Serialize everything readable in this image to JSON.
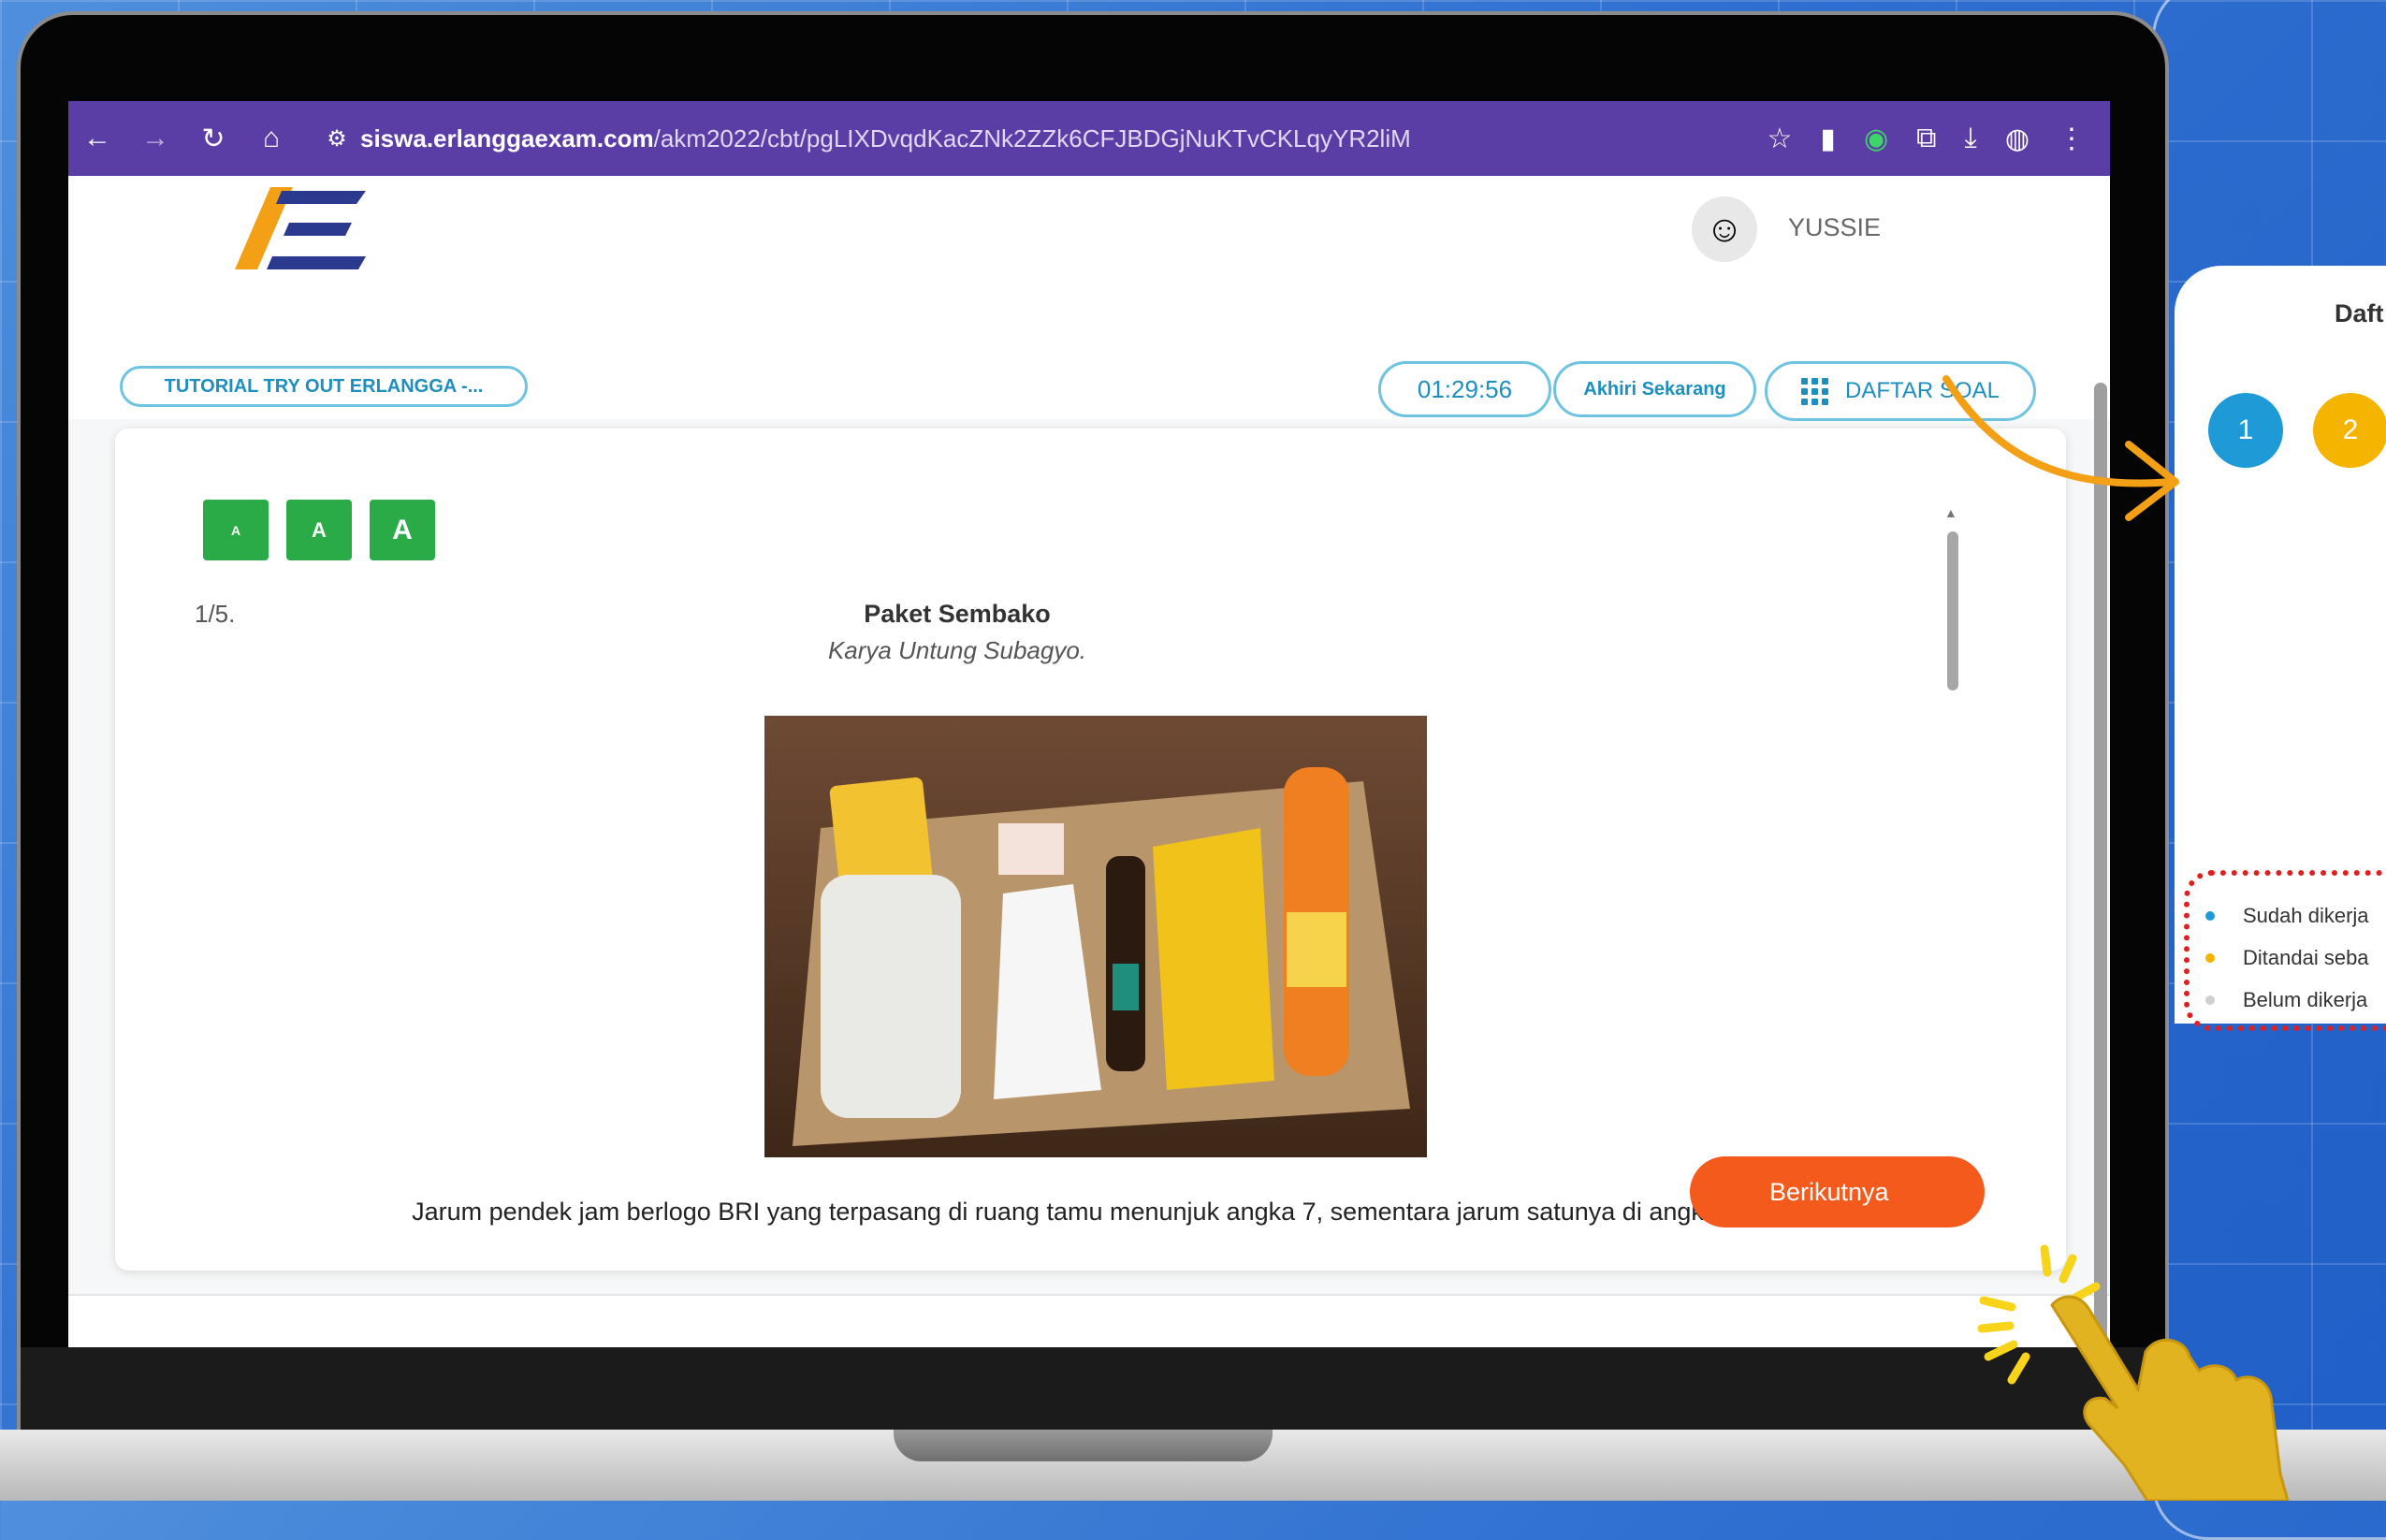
{
  "browser": {
    "url_host": "siswa.erlanggaexam.com",
    "url_path": "/akm2022/cbt/pgLIXDvqdKacZNk2ZZk6CFJBDGjNuKTvCKLqyYR2liM"
  },
  "header": {
    "username": "YUSSIE",
    "tutorial_label": "TUTORIAL TRY OUT ERLANGGA -...",
    "timer": "01:29:56",
    "end_label": "Akhiri Sekarang",
    "question_list_label": "DAFTAR SOAL"
  },
  "font_sizes": [
    "A",
    "A",
    "A"
  ],
  "question": {
    "number": "1/5.",
    "title": "Paket Sembako",
    "author": "Karya Untung Subagyo.",
    "text": "Jarum pendek jam berlogo BRI yang terpasang di ruang tamu menunjuk angka 7, sementara jarum satunya di angka 6."
  },
  "footer": {
    "next_label": "Berikutnya"
  },
  "side_panel": {
    "title": "Daft",
    "numbers": [
      "1",
      "2"
    ],
    "legend": [
      {
        "label": "Sudah dikerja",
        "color": "#1e9ad6"
      },
      {
        "label": "Ditandai seba",
        "color": "#f5b400"
      },
      {
        "label": "Belum dikerja",
        "color": "#cfcfcf"
      }
    ]
  },
  "colors": {
    "browser_bar": "#5b3da6",
    "next_button": "#f35a1c",
    "font_button": "#2bab47",
    "accent": "#1d8fbf"
  }
}
